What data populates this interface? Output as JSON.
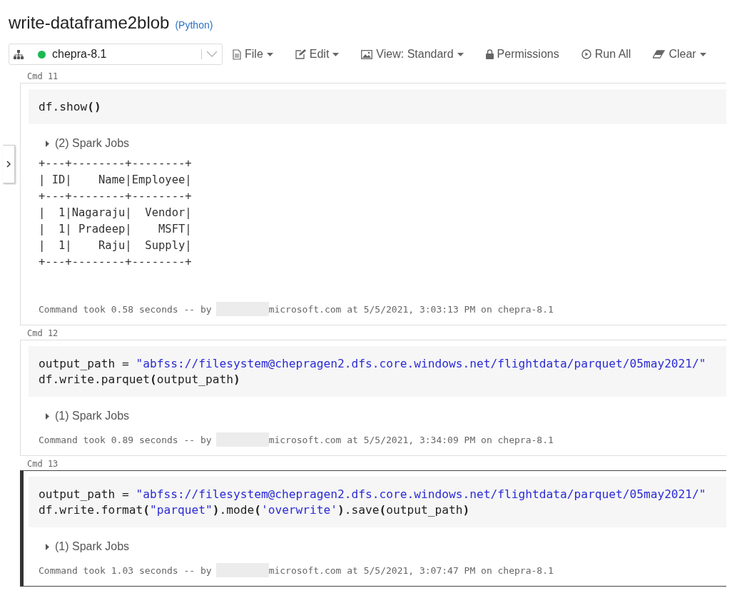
{
  "notebook": {
    "title": "write-dataframe2blob",
    "language": "(Python)"
  },
  "toolbar": {
    "cluster": {
      "name": "chepra-8.1",
      "running": true
    },
    "menus": [
      {
        "label": "File",
        "kind": "file",
        "dropdown": true
      },
      {
        "label": "Edit",
        "kind": "edit",
        "dropdown": true
      },
      {
        "label": "View: Standard",
        "kind": "view",
        "dropdown": true
      },
      {
        "label": "Permissions",
        "kind": "permissions",
        "dropdown": false
      },
      {
        "label": "Run All",
        "kind": "run",
        "dropdown": false
      },
      {
        "label": "Clear",
        "kind": "clear",
        "dropdown": true
      }
    ]
  },
  "cells": [
    {
      "label": "Cmd 11",
      "selected": false,
      "code": [
        [
          {
            "text": "df.show",
            "kind": "plain"
          },
          {
            "text": "()",
            "kind": "paren"
          }
        ]
      ],
      "spark_jobs": "(2) Spark Jobs",
      "output": [
        "+---+--------+--------+",
        "| ID|    Name|Employee|",
        "+---+--------+--------+",
        "|  1|Nagaraju|  Vendor|",
        "|  1| Pradeep|    MSFT|",
        "|  1|    Raju|  Supply|",
        "+---+--------+--------+"
      ],
      "meta_before": "Command took 0.58 seconds -- by",
      "meta_after": "microsoft.com at 5/5/2021, 3:03:13 PM on chepra-8.1"
    },
    {
      "label": "Cmd 12",
      "selected": false,
      "code": [
        [
          {
            "text": "output_path = ",
            "kind": "plain"
          },
          {
            "text": "\"abfss://filesystem@chepragen2.dfs.core.windows.net/flightdata/parquet/05may2021/\"",
            "kind": "string"
          }
        ],
        [
          {
            "text": "df.write.parquet",
            "kind": "plain"
          },
          {
            "text": "(",
            "kind": "paren"
          },
          {
            "text": "output_path",
            "kind": "plain"
          },
          {
            "text": ")",
            "kind": "paren"
          }
        ]
      ],
      "spark_jobs": "(1) Spark Jobs",
      "meta_before": "Command took 0.89 seconds -- by",
      "meta_after": "microsoft.com at 5/5/2021, 3:34:09 PM on chepra-8.1"
    },
    {
      "label": "Cmd 13",
      "selected": true,
      "code": [
        [
          {
            "text": "output_path = ",
            "kind": "plain"
          },
          {
            "text": "\"abfss://filesystem@chepragen2.dfs.core.windows.net/flightdata/parquet/05may2021/\"",
            "kind": "string"
          }
        ],
        [
          {
            "text": "df.write.format",
            "kind": "plain"
          },
          {
            "text": "(",
            "kind": "paren"
          },
          {
            "text": "\"parquet\"",
            "kind": "string"
          },
          {
            "text": ")",
            "kind": "paren"
          },
          {
            "text": ".mode",
            "kind": "plain"
          },
          {
            "text": "(",
            "kind": "paren"
          },
          {
            "text": "'overwrite'",
            "kind": "string"
          },
          {
            "text": ")",
            "kind": "paren"
          },
          {
            "text": ".save",
            "kind": "plain"
          },
          {
            "text": "(",
            "kind": "paren"
          },
          {
            "text": "output_path",
            "kind": "plain"
          },
          {
            "text": ")",
            "kind": "paren"
          }
        ]
      ],
      "spark_jobs": "(1) Spark Jobs",
      "meta_before": "Command took 1.03 seconds -- by",
      "meta_after": "microsoft.com at 5/5/2021, 3:07:47 PM on chepra-8.1"
    }
  ]
}
